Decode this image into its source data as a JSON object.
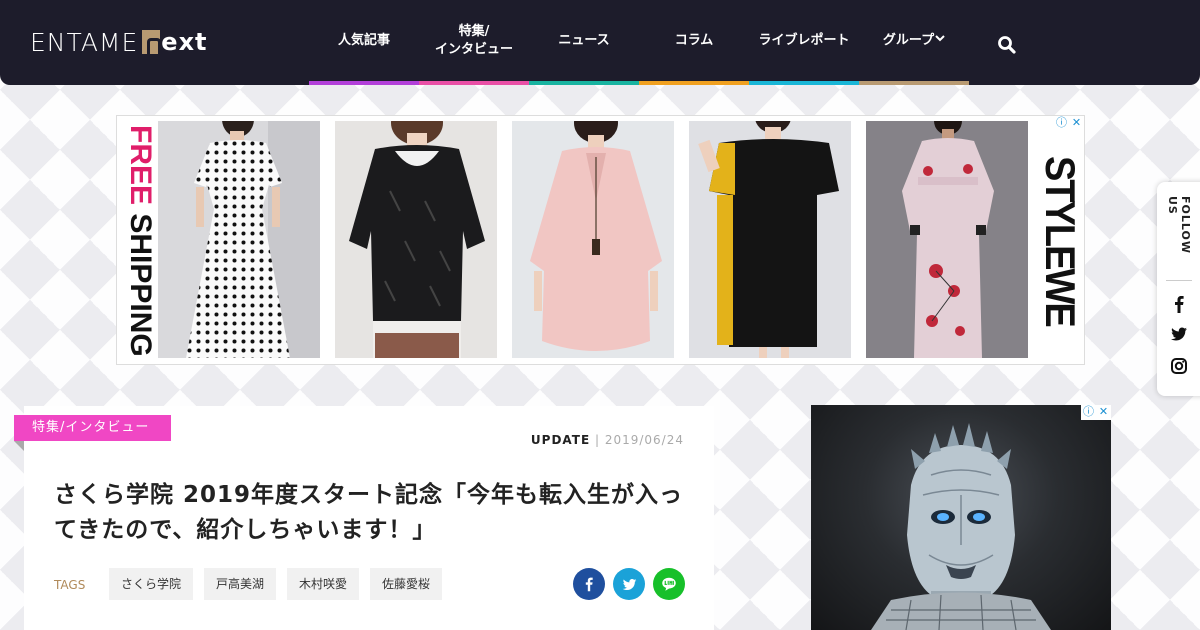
{
  "header": {
    "logo_word1": "ENTAME",
    "logo_word2": "ext",
    "nav": [
      {
        "label": "人気記事",
        "color": "#b23fd9"
      },
      {
        "label": "特集/\nインタビュー",
        "color": "#e94fa6"
      },
      {
        "label": "ニュース",
        "color": "#18b3a0"
      },
      {
        "label": "コラム",
        "color": "#f0a020"
      },
      {
        "label": "ライブレポート",
        "color": "#19b6d7"
      },
      {
        "label": "グループ",
        "color": "#b89a72"
      }
    ],
    "search_icon": "search-icon"
  },
  "top_ad": {
    "free": "FREE ",
    "shipping": "SHIPPING",
    "brand": "STYLEWE",
    "info_icon": "ⓘ",
    "close_icon": "✕"
  },
  "follow": {
    "label": "FOLLOW US",
    "icons": [
      "facebook-icon",
      "twitter-icon",
      "instagram-icon"
    ]
  },
  "article": {
    "category": "特集/インタビュー",
    "update_label": "UPDATE",
    "update_sep": " | ",
    "date": "2019/06/24",
    "title": "さくら学院 2019年度スタート記念「今年も転入生が入ってきたので、紹介しちゃいます！」",
    "tags_label": "TAGS",
    "tags": [
      "さくら学院",
      "戸高美湖",
      "木村咲愛",
      "佐藤愛桜"
    ],
    "share": [
      {
        "name": "facebook",
        "color": "#1f4f9e"
      },
      {
        "name": "twitter",
        "color": "#1ba2d8"
      },
      {
        "name": "line",
        "color": "#17c02a"
      }
    ]
  },
  "side_ad": {
    "info_icon": "ⓘ",
    "close_icon": "✕"
  }
}
